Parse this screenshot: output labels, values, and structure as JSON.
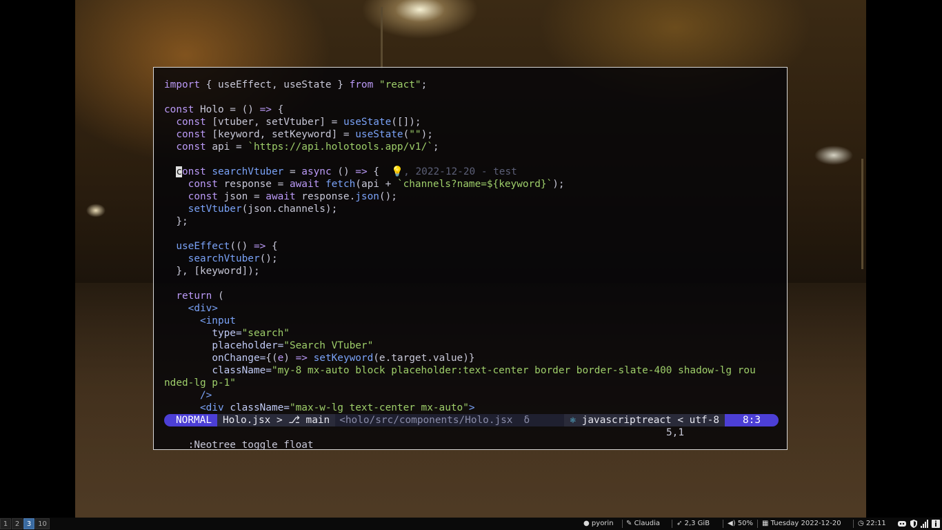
{
  "editor": {
    "lines": [
      [
        [
          "kw",
          "import"
        ],
        [
          "par",
          " { useEffect, useState } "
        ],
        [
          "kw",
          "from"
        ],
        [
          "par",
          " "
        ],
        [
          "str",
          "\"react\""
        ],
        [
          "par",
          ";"
        ]
      ],
      [],
      [
        [
          "kw",
          "const"
        ],
        [
          "par",
          " Holo = () "
        ],
        [
          "kw",
          "=>"
        ],
        [
          "par",
          " {"
        ]
      ],
      [
        [
          "par",
          "  "
        ],
        [
          "kw",
          "const"
        ],
        [
          "par",
          " [vtuber, setVtuber] = "
        ],
        [
          "fn",
          "useState"
        ],
        [
          "par",
          "([]);"
        ]
      ],
      [
        [
          "par",
          "  "
        ],
        [
          "kw",
          "const"
        ],
        [
          "par",
          " [keyword, setKeyword] = "
        ],
        [
          "fn",
          "useState"
        ],
        [
          "par",
          "("
        ],
        [
          "str",
          "\"\""
        ],
        [
          "par",
          ");"
        ]
      ],
      [
        [
          "par",
          "  "
        ],
        [
          "kw",
          "const"
        ],
        [
          "par",
          " api = "
        ],
        [
          "str",
          "`https://api.holotools.app/v1/`"
        ],
        [
          "par",
          ";"
        ]
      ],
      [],
      [
        [
          "par",
          "  "
        ],
        [
          "cursor",
          "c"
        ],
        [
          "kw",
          "onst"
        ],
        [
          "par",
          " "
        ],
        [
          "fn",
          "searchVtuber"
        ],
        [
          "par",
          " = "
        ],
        [
          "kw",
          "async"
        ],
        [
          "par",
          " () "
        ],
        [
          "kw",
          "=>"
        ],
        [
          "par",
          " {  "
        ],
        [
          "ghost",
          "💡, 2022-12-20 - test"
        ]
      ],
      [
        [
          "par",
          "    "
        ],
        [
          "kw",
          "const"
        ],
        [
          "par",
          " response = "
        ],
        [
          "kw",
          "await"
        ],
        [
          "par",
          " "
        ],
        [
          "fn",
          "fetch"
        ],
        [
          "par",
          "(api + "
        ],
        [
          "str",
          "`channels?name=${keyword}`"
        ],
        [
          "par",
          ");"
        ]
      ],
      [
        [
          "par",
          "    "
        ],
        [
          "kw",
          "const"
        ],
        [
          "par",
          " json = "
        ],
        [
          "kw",
          "await"
        ],
        [
          "par",
          " response."
        ],
        [
          "fn",
          "json"
        ],
        [
          "par",
          "();"
        ]
      ],
      [
        [
          "par",
          "    "
        ],
        [
          "fn",
          "setVtuber"
        ],
        [
          "par",
          "(json.channels);"
        ]
      ],
      [
        [
          "par",
          "  };"
        ]
      ],
      [],
      [
        [
          "par",
          "  "
        ],
        [
          "fn",
          "useEffect"
        ],
        [
          "par",
          "(() "
        ],
        [
          "kw",
          "=>"
        ],
        [
          "par",
          " {"
        ]
      ],
      [
        [
          "par",
          "    "
        ],
        [
          "fn",
          "searchVtuber"
        ],
        [
          "par",
          "();"
        ]
      ],
      [
        [
          "par",
          "  }, [keyword]);"
        ]
      ],
      [],
      [
        [
          "par",
          "  "
        ],
        [
          "kw",
          "return"
        ],
        [
          "par",
          " ("
        ]
      ],
      [
        [
          "par",
          "    "
        ],
        [
          "tag",
          "<div>"
        ]
      ],
      [
        [
          "par",
          "      "
        ],
        [
          "tag",
          "<input"
        ]
      ],
      [
        [
          "par",
          "        "
        ],
        [
          "attr",
          "type="
        ],
        [
          "str",
          "\"search\""
        ]
      ],
      [
        [
          "par",
          "        "
        ],
        [
          "attr",
          "placeholder="
        ],
        [
          "str",
          "\"Search VTuber\""
        ]
      ],
      [
        [
          "par",
          "        "
        ],
        [
          "attr",
          "onChange="
        ],
        [
          "par",
          "{("
        ],
        [
          "kw",
          "e"
        ],
        [
          "par",
          ") "
        ],
        [
          "kw",
          "=>"
        ],
        [
          "par",
          " "
        ],
        [
          "fn",
          "setKeyword"
        ],
        [
          "par",
          "(e.target.value)}"
        ]
      ],
      [
        [
          "par",
          "        "
        ],
        [
          "attr",
          "className="
        ],
        [
          "str",
          "\"my-8 mx-auto block placeholder:text-center border border-slate-400 shadow-lg rou"
        ]
      ],
      [
        [
          "str",
          "nded-lg p-1\""
        ]
      ],
      [
        [
          "par",
          "      "
        ],
        [
          "tag",
          "/>"
        ]
      ],
      [
        [
          "par",
          "      "
        ],
        [
          "tag",
          "<div"
        ],
        [
          "par",
          " "
        ],
        [
          "attr",
          "className="
        ],
        [
          "str",
          "\"max-w-lg text-center mx-auto\""
        ],
        [
          "tag",
          ">"
        ]
      ]
    ],
    "statusline": {
      "mode": "NORMAL",
      "file": "Holo.jsx > ",
      "branch_icon": "git-branch-icon",
      "branch": " main",
      "path": "<holo/src/components/Holo.jsx",
      "delta": "δ",
      "filetype_icon": "react-icon",
      "filetype": " javascriptreact < utf-8",
      "position": "8:3"
    },
    "cmdline": {
      "command": ":Neotree toggle float",
      "position": "5,1"
    }
  },
  "taskbar": {
    "workspaces": [
      {
        "label": "1",
        "active": false
      },
      {
        "label": "2",
        "active": false
      },
      {
        "label": "3",
        "active": true
      },
      {
        "label": "10",
        "active": false
      }
    ],
    "user": "pyorin",
    "user_icon": "github-icon",
    "host": "Claudia",
    "host_icon": "wrench-icon",
    "memory": "2,3 GiB",
    "memory_icon": "rocket-icon",
    "volume": "50%",
    "volume_icon": "speaker-icon",
    "date": "Tuesday 2022-12-20",
    "date_icon": "calendar-icon",
    "time": "22:11",
    "time_icon": "clock-icon",
    "tray": [
      "discord-icon",
      "shield-icon",
      "signal-icon",
      "info-icon"
    ]
  }
}
